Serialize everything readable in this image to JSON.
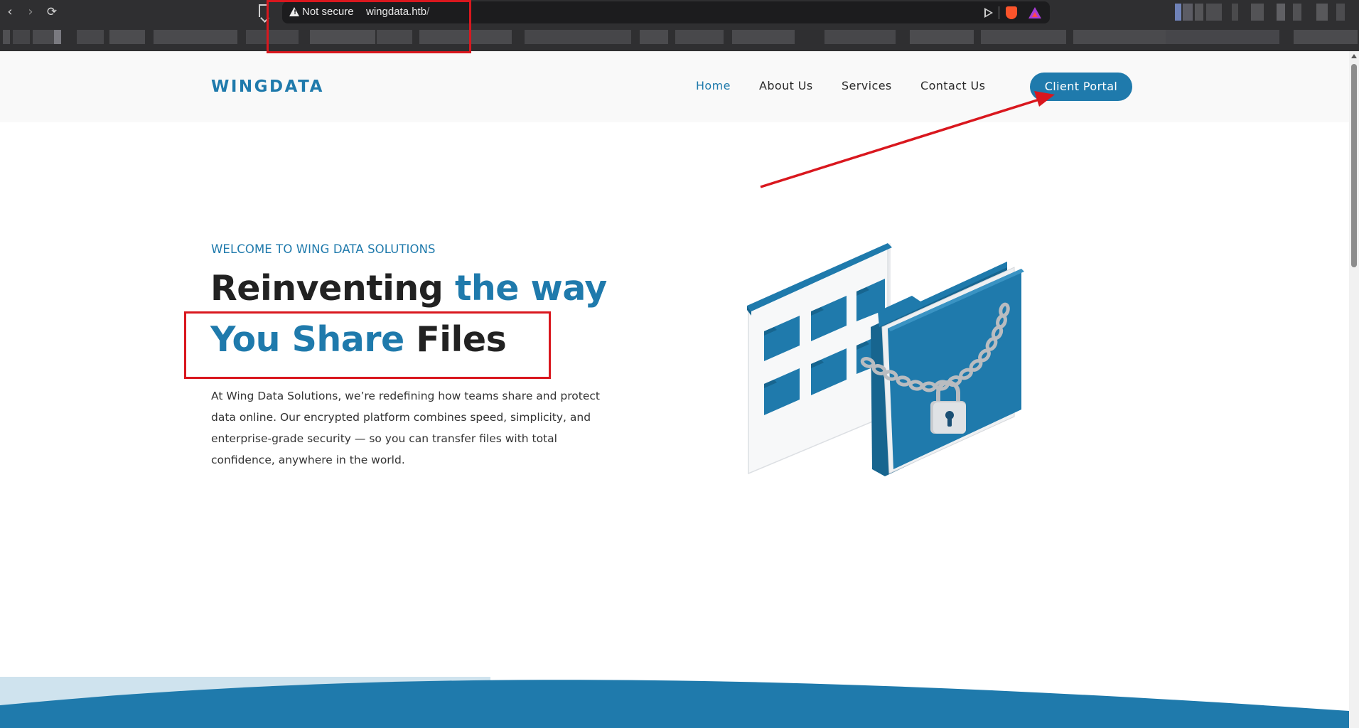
{
  "browser": {
    "back_icon": "chevron-left-icon",
    "forward_icon": "chevron-right-icon",
    "reload_icon": "reload-icon",
    "security_label": "Not secure",
    "url_host": "wingdata.htb",
    "url_path": "/"
  },
  "site": {
    "logo": "WINGDATA",
    "nav": [
      {
        "label": "Home",
        "active": true
      },
      {
        "label": "About Us",
        "active": false
      },
      {
        "label": "Services",
        "active": false
      },
      {
        "label": "Contact Us",
        "active": false
      }
    ],
    "portal_button": "Client Portal"
  },
  "hero": {
    "eyebrow": "WELCOME TO WING DATA SOLUTIONS",
    "headline_part1": "Reinventing ",
    "headline_part2": "the way",
    "headline_part3": "You Share",
    "headline_part4": " Files",
    "paragraph": "At Wing Data Solutions, we’re redefining how teams share and protect data online. Our encrypted platform combines speed, simplicity, and enterprise-grade security — so you can transfer files with total confidence, anywhere in the world."
  },
  "colors": {
    "brand": "#1f7aac",
    "dark_text": "#222222",
    "header_bg": "#f9f9f9",
    "annotation_red": "#d9171e",
    "chrome_bg": "#2f2f31"
  }
}
